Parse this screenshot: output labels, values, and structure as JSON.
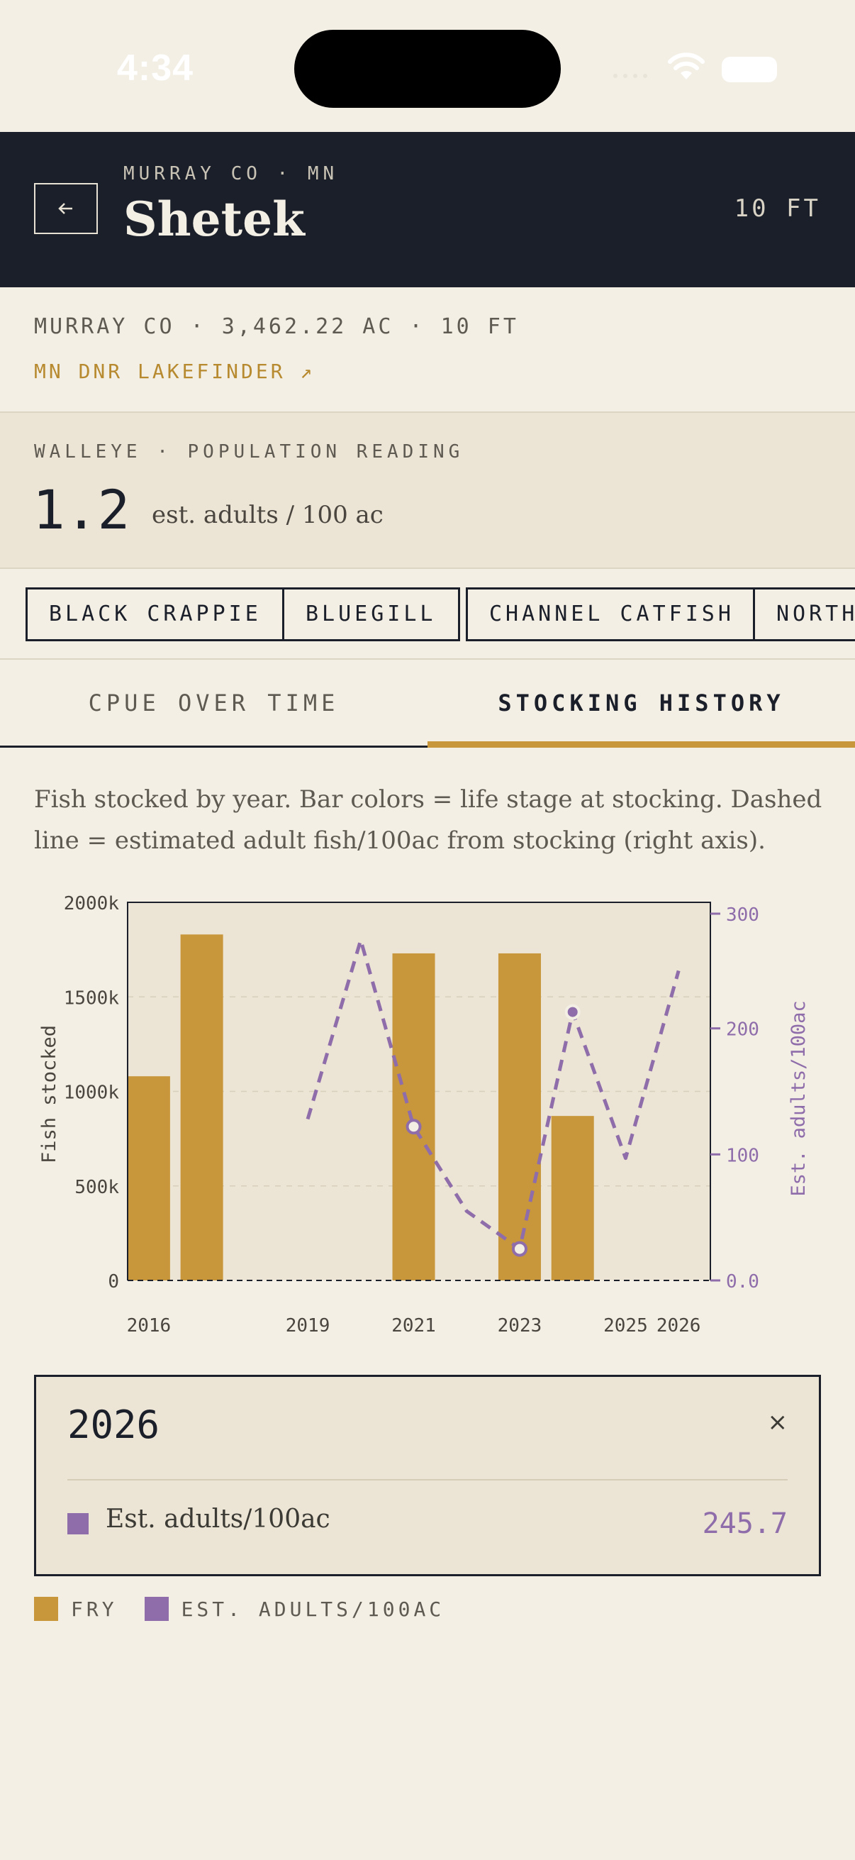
{
  "status_bar": {
    "time": "4:34"
  },
  "header": {
    "back_icon": "arrow-left-icon",
    "county": "MURRAY CO · MN",
    "lake_name": "Shetek",
    "depth": "10 FT"
  },
  "meta": {
    "line": "MURRAY CO · 3,462.22 AC · 10 FT",
    "link": "MN DNR LAKEFINDER ↗"
  },
  "reading": {
    "label": "WALLEYE · POPULATION READING",
    "value": "1.2",
    "unit": "est. adults / 100 ac"
  },
  "species_chips": [
    "BLACK CRAPPIE",
    "BLUEGILL",
    "CHANNEL CATFISH",
    "NORTH"
  ],
  "tabs": [
    {
      "label": "CPUE OVER TIME",
      "active": false
    },
    {
      "label": "STOCKING HISTORY",
      "active": true
    }
  ],
  "description": "Fish stocked by year. Bar colors = life stage at stocking. Dashed line = estimated adult fish/100ac from stocking (right axis).",
  "chart_data": {
    "type": "bar",
    "x_ticks": [
      "2016",
      "2019",
      "2021",
      "2023",
      "2025",
      "2026"
    ],
    "xlim": [
      2015.6,
      2026.6
    ],
    "ylabel": "Fish stocked",
    "ylim": [
      0,
      2000000
    ],
    "y_ticks": [
      "0",
      "500k",
      "1000k",
      "1500k",
      "2000k"
    ],
    "y_tick_values": [
      0,
      500000,
      1000000,
      1500000,
      2000000
    ],
    "y2label": "Est. adults/100ac",
    "y2lim": [
      0,
      300
    ],
    "y2_ticks": [
      "0.0",
      "100",
      "200",
      "300"
    ],
    "y2_tick_values": [
      0,
      100,
      200,
      300
    ],
    "grid": true,
    "series": [
      {
        "name": "FRY",
        "type": "bar",
        "color": "#c8973b",
        "x": [
          2016,
          2017,
          2021,
          2023,
          2024
        ],
        "values": [
          1080000,
          1830000,
          1730000,
          1730000,
          870000
        ]
      },
      {
        "name": "EST. ADULTS/100AC",
        "type": "line",
        "style": "dashed",
        "color": "#8e6daa",
        "x": [
          2019,
          2020,
          2021,
          2022,
          2023,
          2024,
          2025,
          2026
        ],
        "values": [
          128,
          270,
          122,
          55,
          25,
          213,
          97,
          245.7
        ],
        "marked_x": [
          2021,
          2023,
          2024
        ]
      }
    ]
  },
  "tooltip": {
    "year": "2026",
    "close": "×",
    "label": "Est. adults/100ac",
    "value": "245.7",
    "swatch_color": "#8e6daa"
  },
  "legend": [
    {
      "label": "FRY",
      "color": "#c8973b"
    },
    {
      "label": "EST. ADULTS/100AC",
      "color": "#8e6daa"
    }
  ]
}
